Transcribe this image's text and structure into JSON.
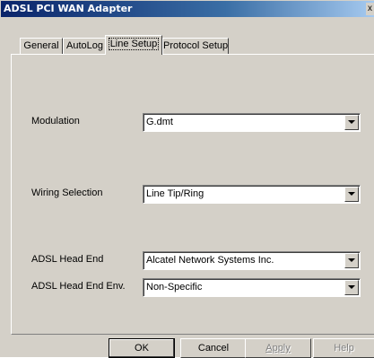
{
  "window": {
    "title": "ADSL PCI WAN Adapter",
    "close_glyph": "x"
  },
  "tabs": [
    {
      "label": "General",
      "active": false
    },
    {
      "label": "AutoLog",
      "active": false
    },
    {
      "label": "Line Setup",
      "active": true
    },
    {
      "label": "Protocol Setup",
      "active": false
    }
  ],
  "fields": {
    "modulation": {
      "label": "Modulation",
      "value": "G.dmt"
    },
    "wiring": {
      "label": "Wiring Selection",
      "value": "Line Tip/Ring"
    },
    "head_end": {
      "label": "ADSL Head End",
      "value": "Alcatel Network Systems Inc."
    },
    "head_end_env": {
      "label": "ADSL Head End Env.",
      "value": "Non-Specific"
    }
  },
  "buttons": {
    "ok": "OK",
    "cancel": "Cancel",
    "apply": "Apply",
    "help": "Help"
  },
  "icons": {
    "dropdown": "chevron-down-icon"
  }
}
